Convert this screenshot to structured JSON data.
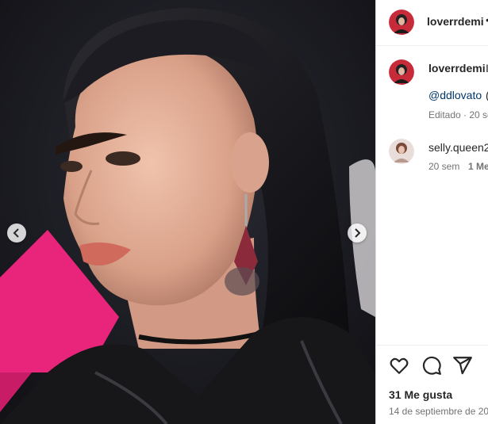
{
  "header": {
    "username": "loverrdemi",
    "more": "•"
  },
  "caption": {
    "username": "loverrdemi",
    "trailing": "I",
    "mention": "@ddlovato",
    "mention_suffix": "(",
    "meta": "Editado · 20 se"
  },
  "comment": {
    "username": "selly.queen2",
    "time": "20 sem",
    "likes": "1 Me"
  },
  "actions": {
    "like_icon": "heart-icon",
    "comment_icon": "comment-icon",
    "share_icon": "share-icon"
  },
  "stats": {
    "likes": "31 Me gusta",
    "date": "14 de septiembre de 20"
  },
  "colors": {
    "accent_pink": "#e8257a",
    "link": "#00376b",
    "muted": "#737373"
  }
}
